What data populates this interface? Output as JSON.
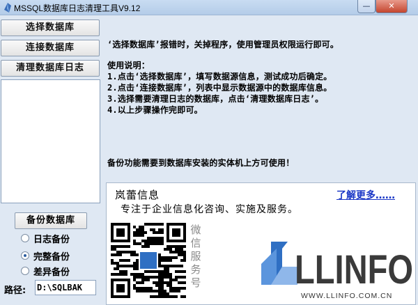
{
  "window": {
    "title": "MSSQL数据库日志清理工具V9.12",
    "minimize_label": "—",
    "close_label": "✕"
  },
  "sidebar": {
    "select_db_label": "选择数据库",
    "connect_db_label": "连接数据库",
    "clean_log_label": "清理数据库日志",
    "backup_label": "备份数据库",
    "backup_options": [
      {
        "label": "日志备份",
        "selected": false
      },
      {
        "label": "完整备份",
        "selected": true
      },
      {
        "label": "差异备份",
        "selected": false
      }
    ],
    "path_label": "路径:",
    "path_value": "D:\\SQLBAK"
  },
  "main": {
    "warning": "‘选择数据库’报错时，关掉程序，使用管理员权限运行即可。",
    "usage_title": "使用说明：",
    "steps": [
      "1.点击‘选择数据库’，填写数据源信息，测试成功后确定。",
      "2.点击‘连接数据库’，列表中显示数据源中的数据库信息。",
      "3.选择需要清理日志的数据库，点击‘清理数据库日志’。",
      "4.以上步骤操作完即可。"
    ],
    "backup_note": "备份功能需要到数据库安装的实体机上方可使用！"
  },
  "ad": {
    "company": "岚蕾信息",
    "learn_more": "了解更多……",
    "slogan": "专注于企业信息化咨询、实施及服务。",
    "wechat_chars": [
      "微",
      "信",
      "服",
      "务",
      "号"
    ],
    "logo_text": "LLINFO",
    "logo_url": "WWW.LLINFO.COM.CN",
    "colors": {
      "logo_blue": "#2f6fc3",
      "logo_dark": "#3a3a3a",
      "link": "#1a37c6"
    }
  }
}
